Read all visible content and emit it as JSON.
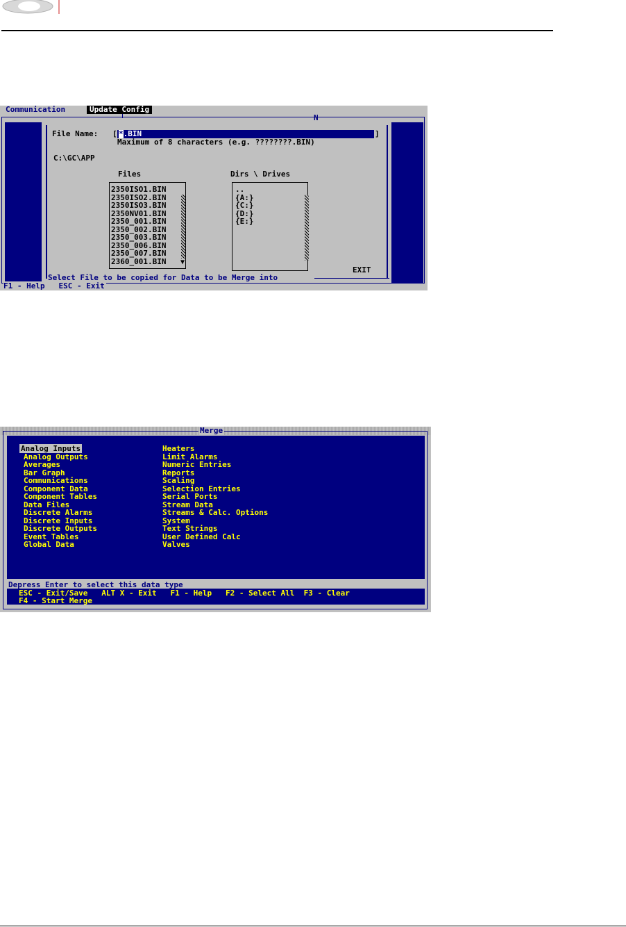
{
  "screen1": {
    "menu": [
      "Communication",
      "Update Config"
    ],
    "frame_marker": "N",
    "file_name_label": "File Name:",
    "file_name_value": "*.BIN",
    "file_name_cursor": "*",
    "file_name_rest": ".BIN",
    "hint": "Maximum of 8 characters (e.g. ????????.BIN)",
    "path": "C:\\GC\\APP",
    "files_header": "Files",
    "dirs_header": "Dirs \\ Drives",
    "files": [
      "2350ISO1.BIN",
      "2350ISO2.BIN",
      "2350ISO3.BIN",
      "2350NV01.BIN",
      "2350_001.BIN",
      "2350_002.BIN",
      "2350_003.BIN",
      "2350_006.BIN",
      "2350_007.BIN",
      "2360_001.BIN"
    ],
    "dirs": [
      "..",
      "{A:}",
      "{C:}",
      "{D:}",
      "{E:}"
    ],
    "exit_label": "EXIT",
    "status": "Select File to be copied for Data to be Merge into",
    "help": "F1 - Help   ESC - Exit"
  },
  "screen2": {
    "title": "Merge",
    "left_items": [
      "Analog Inputs",
      "Analog Outputs",
      "Averages",
      "Bar Graph",
      "Communications",
      "Component Data",
      "Component Tables",
      "Data Files",
      "Discrete Alarms",
      "Discrete Inputs",
      "Discrete Outputs",
      "Event Tables",
      "Global Data"
    ],
    "right_items": [
      "Heaters",
      "Limit Alarms",
      "Numeric Entries",
      "Reports",
      "Scaling",
      "Selection Entries",
      "Serial Ports",
      "Stream Data",
      "Streams & Calc. Options",
      "System",
      "Text Strings",
      "User Defined Calc",
      "Valves"
    ],
    "status": "Depress Enter to select this data type",
    "keys_line1": "ESC - Exit/Save   ALT X - Exit   F1 - Help   F2 - Select All  F3 - Clear",
    "keys_line2": "F4 - Start Merge"
  }
}
